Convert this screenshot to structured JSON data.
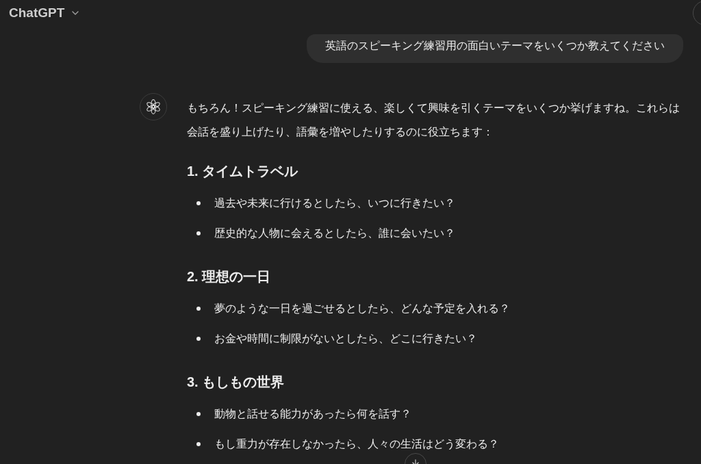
{
  "header": {
    "title": "ChatGPT"
  },
  "user_message": {
    "text": "英語のスピーキング練習用の面白いテーマをいくつか教えてください"
  },
  "assistant_message": {
    "intro": "もちろん！スピーキング練習に使える、楽しくて興味を引くテーマをいくつか挙げますね。これらは会話を盛り上げたり、語彙を増やしたりするのに役立ちます：",
    "sections": [
      {
        "heading": "1. タイムトラベル",
        "items": [
          "過去や未来に行けるとしたら、いつに行きたい？",
          "歴史的な人物に会えるとしたら、誰に会いたい？"
        ]
      },
      {
        "heading": "2. 理想の一日",
        "items": [
          "夢のような一日を過ごせるとしたら、どんな予定を入れる？",
          "お金や時間に制限がないとしたら、どこに行きたい？"
        ]
      },
      {
        "heading": "3. もしもの世界",
        "items": [
          "動物と話せる能力があったら何を話す？",
          "もし重力が存在しなかったら、人々の生活はどう変わる？"
        ]
      }
    ]
  }
}
